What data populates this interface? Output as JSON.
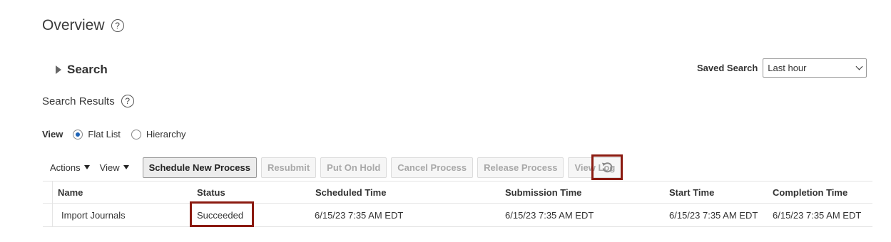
{
  "header": {
    "title": "Overview",
    "help": "?"
  },
  "search": {
    "label": "Search"
  },
  "saved_search": {
    "label": "Saved Search",
    "value": "Last hour"
  },
  "results": {
    "title": "Search Results",
    "help": "?"
  },
  "view": {
    "label": "View",
    "options": [
      "Flat List",
      "Hierarchy"
    ],
    "selected": "Flat List"
  },
  "toolbar": {
    "actions_label": "Actions",
    "view_label": "View",
    "schedule_label": "Schedule New Process",
    "resubmit_label": "Resubmit",
    "hold_label": "Put On Hold",
    "cancel_label": "Cancel Process",
    "release_label": "Release Process",
    "viewlog_label": "View Log"
  },
  "table": {
    "columns": [
      "Name",
      "Status",
      "Scheduled Time",
      "Submission Time",
      "Start Time",
      "Completion Time"
    ],
    "rows": [
      [
        "Import Journals",
        "Succeeded",
        "6/15/23 7:35 AM EDT",
        "6/15/23 7:35 AM EDT",
        "6/15/23 7:35 AM EDT",
        "6/15/23 7:35 AM EDT"
      ]
    ]
  },
  "colors": {
    "highlight": "#8b1a10",
    "radio_selected": "#1e63b6"
  }
}
